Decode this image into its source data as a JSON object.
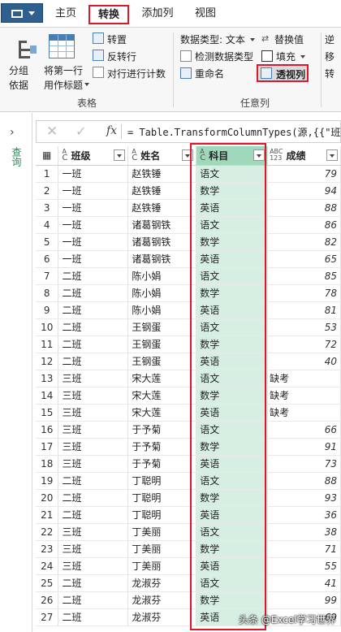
{
  "ribbon_tabs": {
    "home": "主页",
    "transform": "转换",
    "add_column": "添加列",
    "view": "视图"
  },
  "ribbon": {
    "group_by_line1": "分组",
    "group_by_line2": "依据",
    "use_first_row_line1": "将第一行",
    "use_first_row_line2": "用作标题",
    "transpose": "转置",
    "reverse_rows": "反转行",
    "count_rows": "对行进行计数",
    "table_group_label": "表格",
    "data_type": "数据类型: 文本",
    "detect_type": "检测数据类型",
    "rename": "重命名",
    "replace_values": "替换值",
    "fill": "填充",
    "pivot_column": "透视列",
    "any_column_group_label": "任意列",
    "edge_text_1": "逆",
    "edge_text_2": "移",
    "edge_text_3": "转"
  },
  "side_pane_label": "查询",
  "formula": {
    "fx": "fx",
    "text": "= Table.TransformColumnTypes(源,{{\"班级"
  },
  "columns": [
    {
      "type_top": "A",
      "type_sub": "B",
      "type_bot": "C",
      "label": "班级"
    },
    {
      "type_top": "A",
      "type_sub": "B",
      "type_bot": "C",
      "label": "姓名"
    },
    {
      "type_top": "A",
      "type_sub": "B",
      "type_bot": "C",
      "label": "科目"
    },
    {
      "type_top": "ABC",
      "type_sub": "",
      "type_bot": "123",
      "label": "成绩"
    }
  ],
  "rows": [
    [
      "1",
      "一班",
      "赵铁锤",
      "语文",
      "79"
    ],
    [
      "2",
      "一班",
      "赵铁锤",
      "数学",
      "94"
    ],
    [
      "3",
      "一班",
      "赵铁锤",
      "英语",
      "88"
    ],
    [
      "4",
      "一班",
      "诸葛钢铁",
      "语文",
      "86"
    ],
    [
      "5",
      "一班",
      "诸葛钢铁",
      "数学",
      "82"
    ],
    [
      "6",
      "一班",
      "诸葛钢铁",
      "英语",
      "65"
    ],
    [
      "7",
      "二班",
      "陈小娟",
      "语文",
      "85"
    ],
    [
      "8",
      "二班",
      "陈小娟",
      "数学",
      "78"
    ],
    [
      "9",
      "二班",
      "陈小娟",
      "英语",
      "81"
    ],
    [
      "10",
      "二班",
      "王钢蛋",
      "语文",
      "53"
    ],
    [
      "11",
      "二班",
      "王钢蛋",
      "数学",
      "72"
    ],
    [
      "12",
      "二班",
      "王钢蛋",
      "英语",
      "40"
    ],
    [
      "13",
      "三班",
      "宋大莲",
      "语文",
      "缺考"
    ],
    [
      "14",
      "三班",
      "宋大莲",
      "数学",
      "缺考"
    ],
    [
      "15",
      "三班",
      "宋大莲",
      "英语",
      "缺考"
    ],
    [
      "16",
      "三班",
      "于予菊",
      "语文",
      "66"
    ],
    [
      "17",
      "三班",
      "于予菊",
      "数学",
      "91"
    ],
    [
      "18",
      "三班",
      "于予菊",
      "英语",
      "73"
    ],
    [
      "19",
      "二班",
      "丁聪明",
      "语文",
      "88"
    ],
    [
      "20",
      "二班",
      "丁聪明",
      "数学",
      "93"
    ],
    [
      "21",
      "二班",
      "丁聪明",
      "英语",
      "36"
    ],
    [
      "22",
      "三班",
      "丁美丽",
      "语文",
      "38"
    ],
    [
      "23",
      "三班",
      "丁美丽",
      "数学",
      "71"
    ],
    [
      "24",
      "三班",
      "丁美丽",
      "英语",
      "55"
    ],
    [
      "25",
      "二班",
      "龙淑芬",
      "语文",
      "41"
    ],
    [
      "26",
      "二班",
      "龙淑芬",
      "数学",
      "99"
    ],
    [
      "27",
      "二班",
      "龙淑芬",
      "英语",
      "69"
    ]
  ],
  "watermark": "头条 @Excel学习世界",
  "colors": {
    "accent_red": "#e0162b",
    "selected_column": "#d6efe2",
    "selected_header": "#9fd8ba",
    "file_button": "#2e5f8e"
  }
}
